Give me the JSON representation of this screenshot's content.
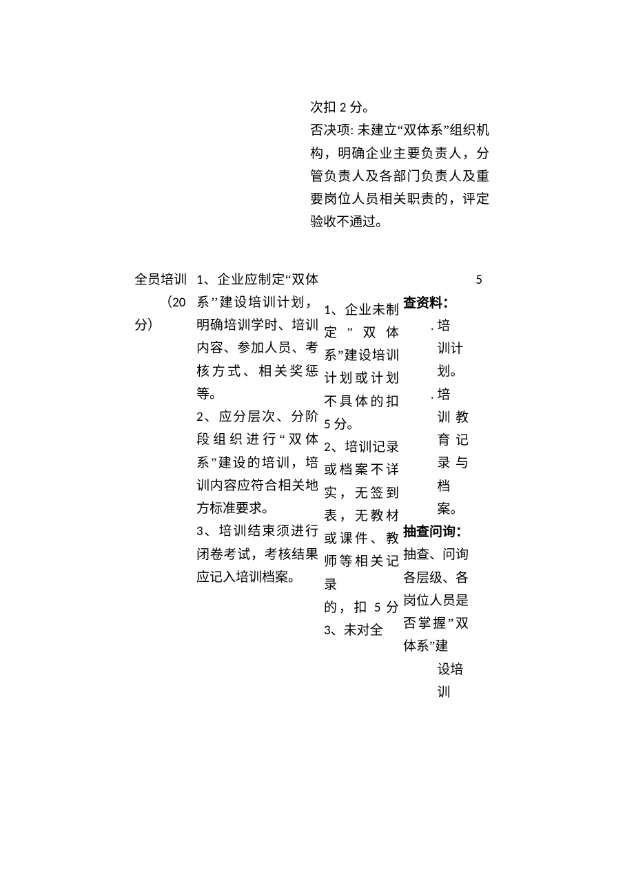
{
  "top": {
    "line1_a": "次扣 ",
    "line1_num": "2",
    "line1_b": " 分。",
    "line2": "否决项: 未建立“双体系”组织机构，明确企业主要负责人，分管负责人及各部门负责人及重要岗位人员相关职责的，评定验收不通过。"
  },
  "col1": {
    "title": "全员培训",
    "score_open": "（",
    "score_num": "20",
    "score_close": "分）"
  },
  "col2": {
    "p1_num": "1",
    "p1": "、企业应制定“双体系’’建设培训计划，明确培训学时、培训内容、参加人员、考核方式、相关奖惩等。",
    "p2_num": "2",
    "p2": "、应分层次、分阶段组织进行“双体系”建设的培训，培训内容应符合相关地方标准要求。",
    "p3_num": "3",
    "p3": "、培训结束须进行闭卷考试，考核结果应记入培训档案。"
  },
  "col3": {
    "p1_num": "1",
    "p1a": "、企业未制定”双体系”建设培训计划或计划不具体的扣 ",
    "p1_num5": "5",
    "p1b": " 分。",
    "p2_num": "2",
    "p2a": "、培训记录或档案不详实，无签到表，无教材或课件、教师等相关记录",
    "p2b_a": "的，扣 ",
    "p2b_num5": "5",
    "p2b_b": " 分 ",
    "p2b_num3": "3",
    "p2b_c": "、未对全"
  },
  "col4": {
    "h1": "查资料：",
    "b1": ". 培",
    "b1b": "训计",
    "b1c": "划。",
    "b2": ". 培",
    "b2b": "训 教 育记 录 与档案。",
    "h2": "抽查问询：",
    "p1": "抽查、问询各层级、各岗位人员是否掌握”双体系”建",
    "p1_last": "设培训"
  },
  "col5": {
    "num": "5"
  }
}
